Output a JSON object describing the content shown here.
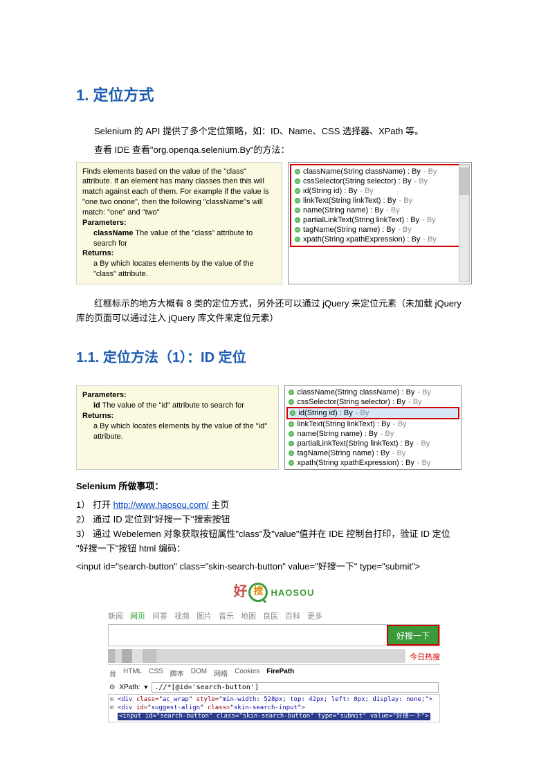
{
  "h1": "1. 定位方式",
  "intro1": "Selenium 的 API 提供了多个定位策略，如：ID、Name、CSS 选择器、XPath 等。",
  "intro2": "查看 IDE 查看\"org.openqa.selenium.By\"的方法：",
  "doc1": {
    "l1": "Finds elements based on the value of the \"class\" attribute. If an element has many classes then this will match against each of them. For example if the value is \"one two onone\", then the following \"className\"s will match: \"one\" and \"two\"",
    "params": "Parameters:",
    "paramline": "className The value of the \"class\" attribute to search for",
    "returns": "Returns:",
    "retline": "a By which locates elements by the value of the \"class\" attribute."
  },
  "api": [
    {
      "sig": "className(String className) : By",
      "ret": " - By"
    },
    {
      "sig": "cssSelector(String selector) : By",
      "ret": " - By"
    },
    {
      "sig": "id(String id) : By",
      "ret": " - By"
    },
    {
      "sig": "linkText(String linkText) : By",
      "ret": " - By"
    },
    {
      "sig": "name(String name) : By",
      "ret": " - By"
    },
    {
      "sig": "partialLinkText(String linkText) : By",
      "ret": " - By"
    },
    {
      "sig": "tagName(String name) : By",
      "ret": " - By"
    },
    {
      "sig": "xpath(String xpathExpression) : By",
      "ret": " - By"
    }
  ],
  "redNote": "红框标示的地方大概有 8 类的定位方式，另外还可以通过 jQuery 来定位元素（未加载 jQuery 库的页面可以通过注入 jQuery 库文件来定位元素）",
  "h2": "1.1. 定位方法（1）：ID 定位",
  "doc2": {
    "params": "Parameters:",
    "paramline": "id The value of the \"id\" attribute to search for",
    "returns": "Returns:",
    "retline": "a By which locates elements by the value of the \"id\" attribute."
  },
  "tasks_title": "Selenium 所做事项：",
  "task1_n": "1）",
  "task1_a": "打开 ",
  "task1_link": "http://www.haosou.com/",
  "task1_b": "  主页",
  "task2_n": "2）",
  "task2": "通过 ID 定位到\"好搜一下\"搜索按钮",
  "task3_n": "3）",
  "task3": "通过 Webelemen 对象获取按钮属性\"class\"及\"value\"值并在 IDE 控制台打印，验证 ID 定位",
  "btn_note": "\"好搜一下\"按钮 html 编码：",
  "btn_code": "<input id=\"search-button\" class=\"skin-search-button\" value=\"好搜一下\" type=\"submit\">",
  "haosou": {
    "hao": "好",
    "sou": "搜",
    "eng": "HAOSOU",
    "tabs": [
      "新闻",
      "网页",
      "问答",
      "视频",
      "图片",
      "音乐",
      "地图",
      "良医",
      "百科",
      "更多"
    ],
    "btn": "好搜一下",
    "hot": "今日热搜"
  },
  "devtabs": [
    "台",
    "HTML",
    "CSS",
    "脚本",
    "DOM",
    "网络",
    "Cookies",
    "FirePath"
  ],
  "xpath_label": "XPath:",
  "xpath_expr": ".//*[@id='search-button']",
  "code": {
    "l1a": "<div class=\"",
    "l1b": "ac_wrap",
    "l1c": "\" style=\"",
    "l1d": "min-width: 528px; top: 42px; left: 0px; display: none;",
    "l1e": "\">",
    "l2a": "<div id=\"",
    "l2b": "suggest-align",
    "l2c": "\" class=\"",
    "l2d": "skin-search-input",
    "l2e": "\">",
    "l3": "<input id=\"search-button\" class=\"skin-search-button\" type=\"submit\" value=\"好搜一下\">"
  }
}
